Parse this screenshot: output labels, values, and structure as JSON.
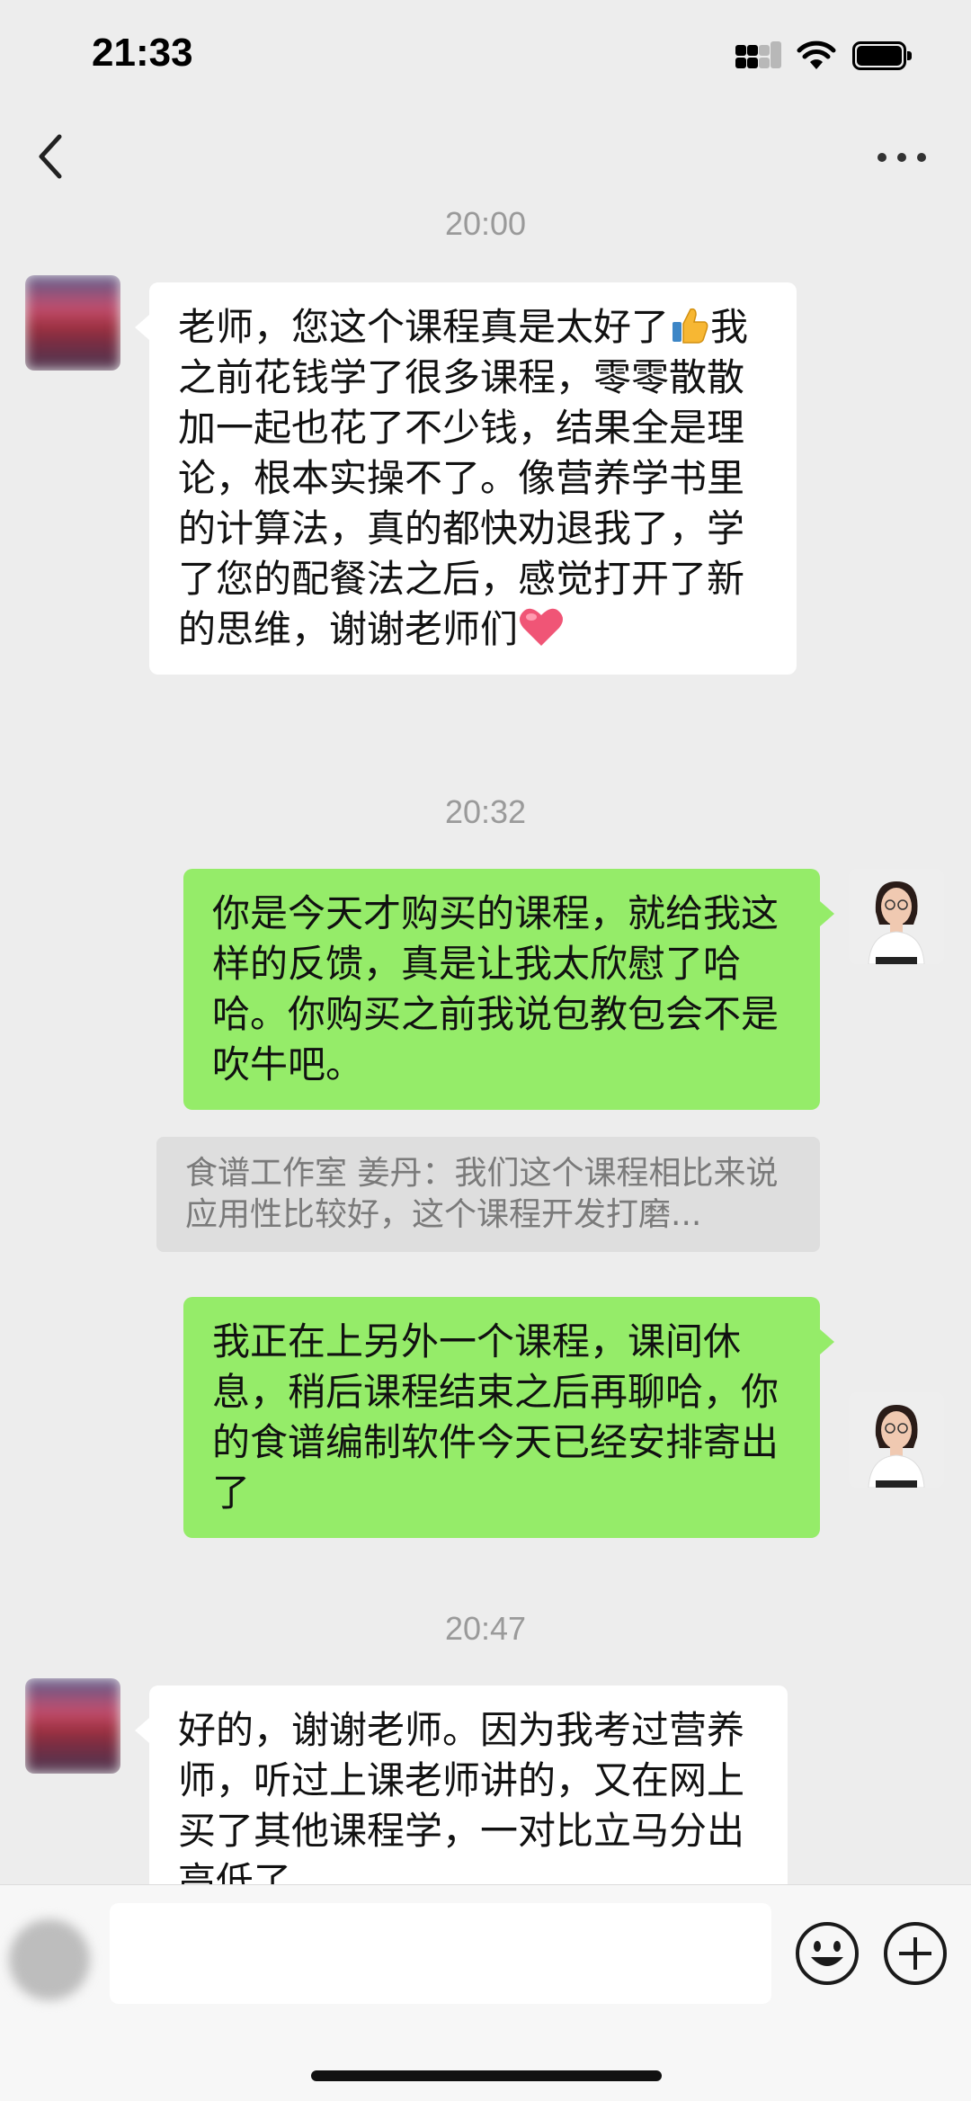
{
  "status_bar": {
    "time": "21:33"
  },
  "nav": {
    "title": ""
  },
  "messages": {
    "t1": "20:00",
    "m1": "老师，您这个课程真是太好了",
    "m1_rest": "我之前花钱学了很多课程，零零散散加一起也花了不少钱，结果全是理论，根本实操不了。像营养学书里的计算法，真的都快劝退我了，学了您的配餐法之后，感觉打开了新的思维，谢谢老师们",
    "t2": "20:32",
    "m2": "你是今天才购买的课程，就给我这样的反馈，真是让我太欣慰了哈哈。你购买之前我说包教包会不是吹牛吧。",
    "quote": "食谱工作室 姜丹：我们这个课程相比来说应用性比较好，这个课程开发打磨...",
    "m3": "我正在上另外一个课程，课间休息，稍后课程结束之后再聊哈，你的食谱编制软件今天已经安排寄出了",
    "t3": "20:47",
    "m4": "好的，谢谢老师。因为我考过营养师，听过上课老师讲的，又在网上买了其他课程学，一对比立马分出高低了"
  },
  "icons": {
    "back": "chevron-left-icon",
    "more": "ellipsis-icon",
    "thumbs_up": "thumbs-up-emoji",
    "heart": "heart-emoji",
    "emoji_button": "smiley-icon",
    "plus_button": "plus-circle-icon"
  },
  "colors": {
    "background": "#ededed",
    "outgoing_bubble": "#95ec69",
    "incoming_bubble": "#ffffff",
    "quote_background": "#dedede"
  }
}
